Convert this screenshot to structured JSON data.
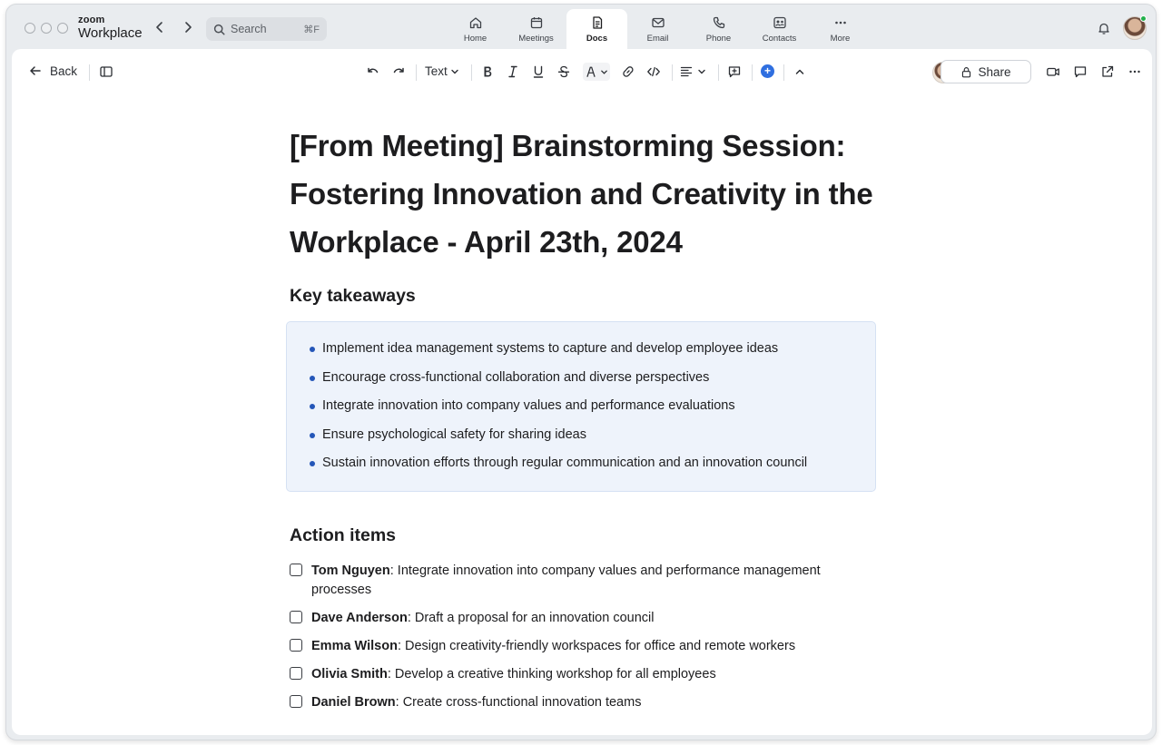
{
  "app": {
    "brand_small": "zoom",
    "brand_big": "Workplace"
  },
  "search": {
    "placeholder": "Search",
    "shortcut": "⌘F"
  },
  "tabs": [
    {
      "label": "Home",
      "icon": "home-icon"
    },
    {
      "label": "Meetings",
      "icon": "calendar-icon"
    },
    {
      "label": "Docs",
      "icon": "document-icon",
      "active": true
    },
    {
      "label": "Email",
      "icon": "mail-icon"
    },
    {
      "label": "Phone",
      "icon": "phone-icon"
    },
    {
      "label": "Contacts",
      "icon": "contacts-icon"
    },
    {
      "label": "More",
      "icon": "more-icon"
    }
  ],
  "status": {
    "online_color": "#22b14c"
  },
  "toolbar": {
    "back_label": "Back",
    "text_style": "Text",
    "share_label": "Share",
    "accent_color": "#2f6fe0"
  },
  "document": {
    "title": "[From Meeting] Brainstorming Session: Fostering Innovation and Creativity in the Workplace - April 23th, 2024",
    "takeaways_heading": "Key takeaways",
    "takeaways": [
      "Implement idea management systems to capture and develop employee ideas",
      "Encourage cross-functional collaboration and diverse perspectives",
      "Integrate innovation into company values and performance evaluations",
      "Ensure psychological safety for sharing ideas",
      "Sustain innovation efforts through regular communication and an innovation council"
    ],
    "action_heading": "Action items",
    "actions": [
      {
        "owner": "Tom Nguyen",
        "task": ": Integrate innovation into company values and performance management processes",
        "done": false
      },
      {
        "owner": "Dave Anderson",
        "task": ": Draft a proposal for an innovation council",
        "done": false
      },
      {
        "owner": "Emma Wilson",
        "task": ": Design creativity-friendly workspaces for office and remote workers",
        "done": false
      },
      {
        "owner": "Olivia Smith",
        "task": ": Develop a creative thinking workshop for all employees",
        "done": false
      },
      {
        "owner": "Daniel Brown",
        "task": ": Create cross-functional innovation teams",
        "done": false
      }
    ]
  }
}
